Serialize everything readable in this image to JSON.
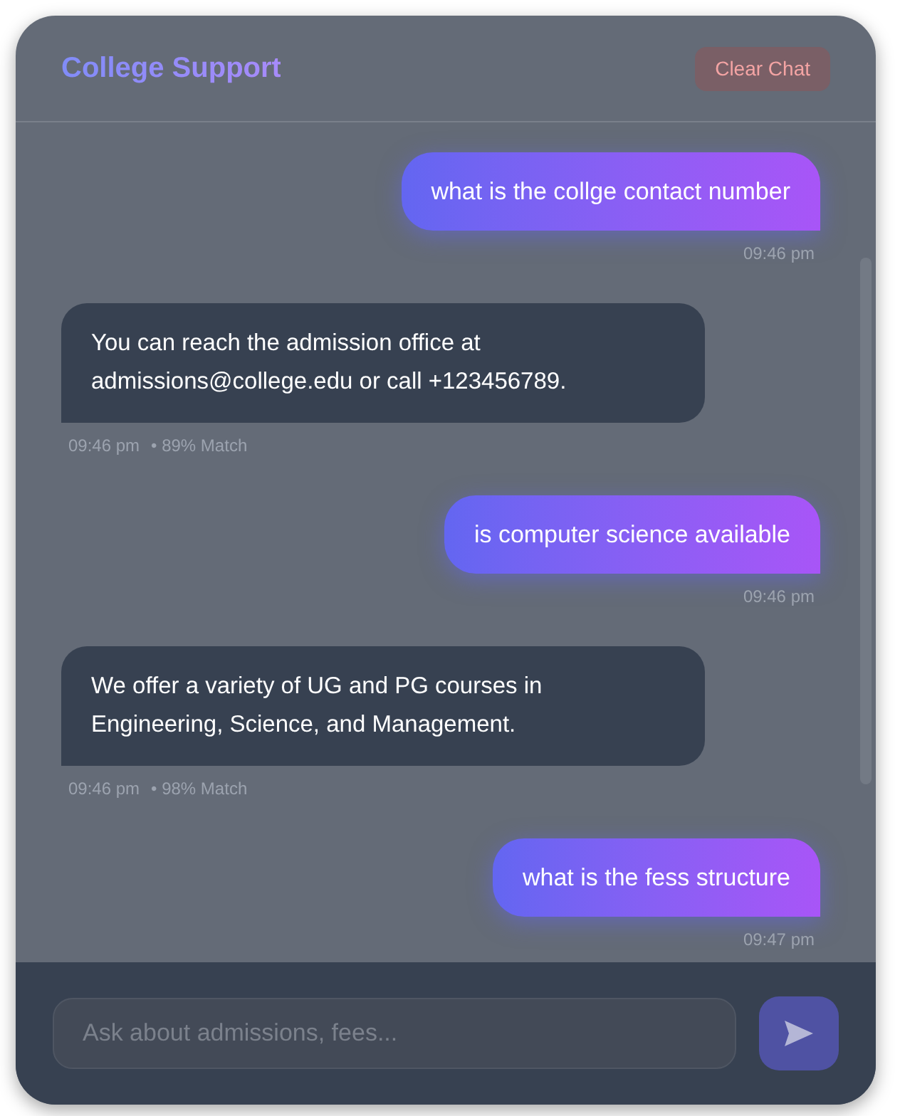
{
  "header": {
    "title": "College Support",
    "clear_button": "Clear Chat"
  },
  "messages": [
    {
      "kind": "user",
      "text": "what is the collge contact number",
      "time": "09:46 pm"
    },
    {
      "kind": "bot",
      "text": "You can reach the admission office at admissions@college.edu or call +123456789.",
      "time": "09:46 pm",
      "match": "• 89% Match"
    },
    {
      "kind": "user",
      "text": "is computer science available",
      "time": "09:46 pm"
    },
    {
      "kind": "bot",
      "text": "We offer a variety of UG and PG courses in Engineering, Science, and Management.",
      "time": "09:46 pm",
      "match": "• 98% Match"
    },
    {
      "kind": "user",
      "text": "what is the fess structure",
      "time": "09:47 pm"
    }
  ],
  "composer": {
    "placeholder": "Ask about admissions, fees..."
  }
}
